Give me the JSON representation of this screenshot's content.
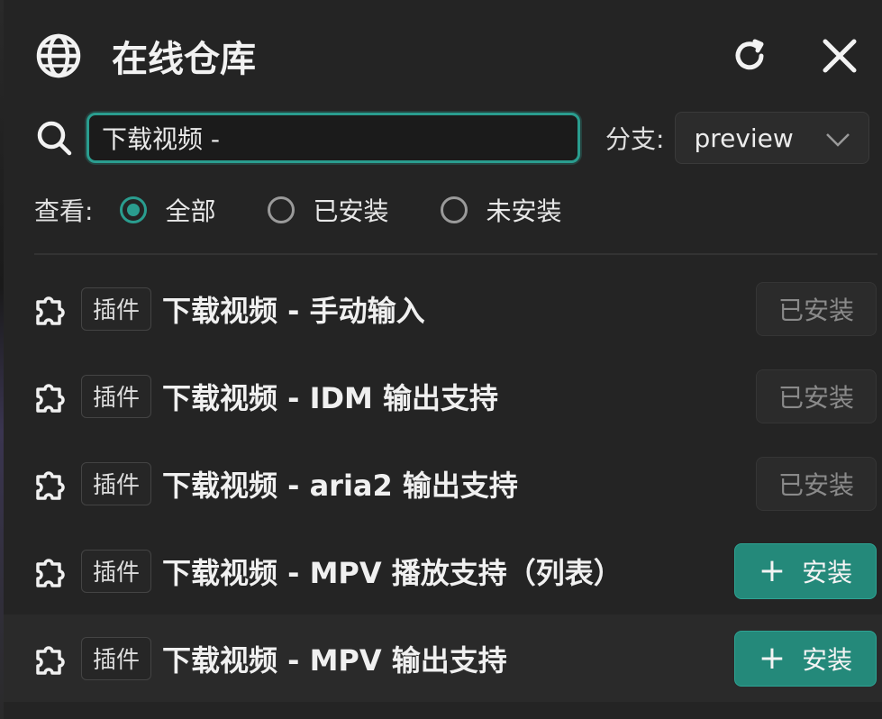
{
  "header": {
    "title": "在线仓库",
    "globe_icon": "globe-icon",
    "refresh_icon": "refresh-icon",
    "close_icon": "close-icon"
  },
  "search": {
    "value": "下载视频 -",
    "placeholder": "",
    "icon": "search-icon"
  },
  "branch": {
    "label": "分支:",
    "selected": "preview"
  },
  "filter": {
    "label": "查看:",
    "options": [
      {
        "label": "全部",
        "checked": true
      },
      {
        "label": "已安装",
        "checked": false
      },
      {
        "label": "未安装",
        "checked": false
      }
    ]
  },
  "items": [
    {
      "tag": "插件",
      "name": "下载视频 - 手动输入",
      "status": "installed",
      "action_label": "已安装"
    },
    {
      "tag": "插件",
      "name": "下载视频 - IDM 输出支持",
      "status": "installed",
      "action_label": "已安装"
    },
    {
      "tag": "插件",
      "name": "下载视频 - aria2 输出支持",
      "status": "installed",
      "action_label": "已安装"
    },
    {
      "tag": "插件",
      "name": "下载视频 - MPV 播放支持（列表）",
      "status": "not_installed",
      "action_label": "安装"
    },
    {
      "tag": "插件",
      "name": "下载视频 - MPV 输出支持",
      "status": "not_installed",
      "action_label": "安装"
    }
  ],
  "colors": {
    "accent": "#2a9d8f",
    "install_button": "#24897a",
    "background": "#242424"
  }
}
